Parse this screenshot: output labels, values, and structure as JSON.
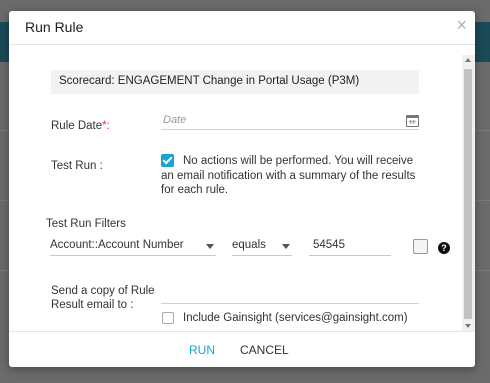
{
  "modal": {
    "title": "Run Rule",
    "close_label": "×"
  },
  "scorecard": {
    "label": "Scorecard: ENGAGEMENT Change in Portal Usage (P3M)"
  },
  "rule_date": {
    "label": "Rule Date",
    "required_marker": "*:",
    "placeholder": "Date"
  },
  "test_run": {
    "label": "Test Run :",
    "checked": true,
    "text": "No actions will be performed. You will receive an email notification with a summary of the results for each rule."
  },
  "filters": {
    "heading": "Test Run Filters",
    "field": "Account::Account Number",
    "operator": "equals",
    "value": "54545",
    "help_glyph": "?"
  },
  "send_copy": {
    "label_line1": "Send a copy of Rule",
    "label_line2": "Result email to :",
    "include_label": "Include Gainsight (services@gainsight.com)",
    "include_checked": false
  },
  "footer": {
    "run_label": "RUN",
    "cancel_label": "CANCEL"
  },
  "colors": {
    "accent": "#1aa3d6",
    "required": "#e0393e",
    "header_bg": "#1a4a57"
  }
}
